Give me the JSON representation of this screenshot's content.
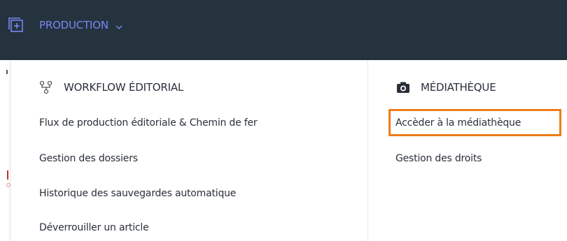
{
  "header": {
    "menu_label": "PRODUCTION",
    "menu_icon": "add-square-icon",
    "chevron_icon": "chevron-down-icon",
    "accent_color": "#7b86f2",
    "background": "#24333e"
  },
  "dropdown": {
    "workflow": {
      "title": "WORKFLOW ÉDITORIAL",
      "icon": "workflow-icon",
      "items": [
        {
          "label": "Flux de production éditoriale & Chemin de fer"
        },
        {
          "label": "Gestion des dossiers"
        },
        {
          "label": "Historique des sauvegardes automatique"
        },
        {
          "label": "Déverrouiller un article"
        }
      ]
    },
    "media": {
      "title": "MÉDIATHÈQUE",
      "icon": "camera-icon",
      "items": [
        {
          "label": "Accèder à la médiathèque",
          "highlighted": true
        },
        {
          "label": "Gestion des droits"
        }
      ]
    }
  },
  "highlight_color": "#ee7c1a"
}
